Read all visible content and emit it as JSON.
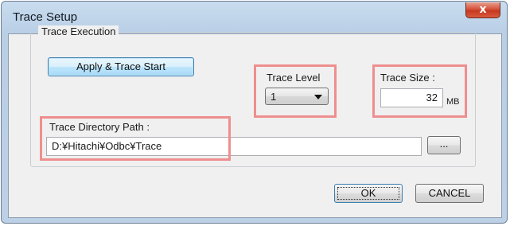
{
  "window": {
    "title": "Trace Setup",
    "close_symbol": "x"
  },
  "group": {
    "label": "Trace Execution"
  },
  "apply_button": {
    "label": "Apply & Trace Start"
  },
  "trace_level": {
    "label": "Trace Level",
    "selected": "1"
  },
  "trace_size": {
    "label": "Trace Size :",
    "value": "32",
    "unit": "MB"
  },
  "trace_path": {
    "label": "Trace Directory Path :",
    "value": "D:¥Hitachi¥Odbc¥Trace"
  },
  "browse_button": {
    "label": "..."
  },
  "ok_button": {
    "label": "OK"
  },
  "cancel_button": {
    "label": "CANCEL"
  },
  "colors": {
    "highlight": "#ef8e8e",
    "close_button": "#c7381f",
    "titlebar": "#c9dcef"
  }
}
